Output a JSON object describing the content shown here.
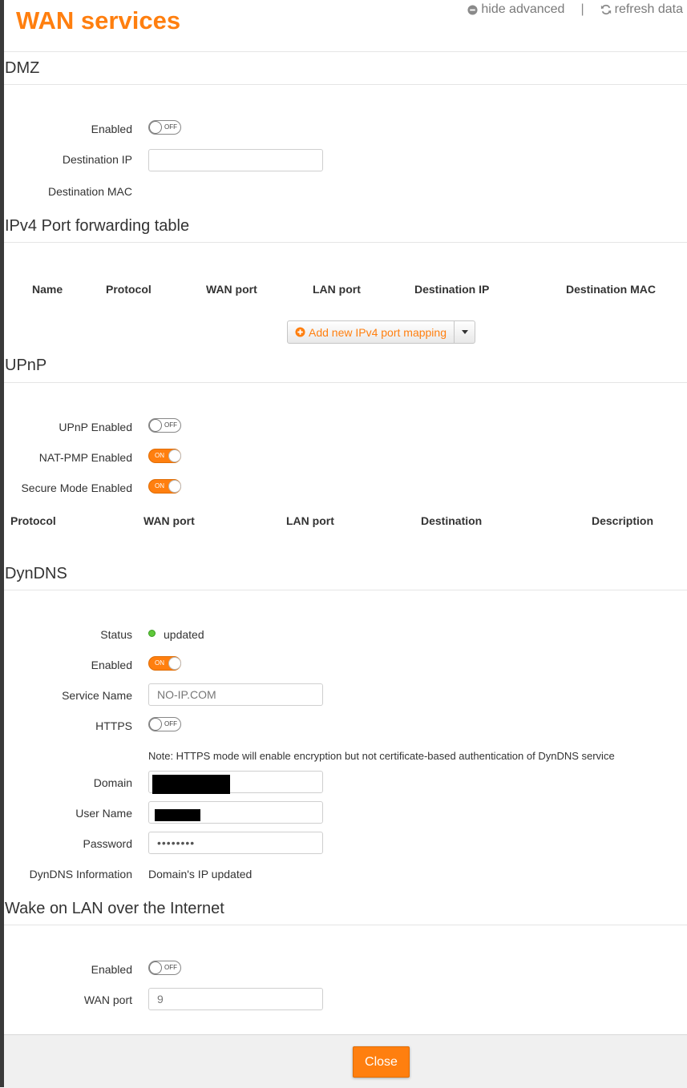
{
  "page": {
    "title": "WAN services"
  },
  "header": {
    "hide_advanced": "hide advanced",
    "separator": "|",
    "refresh_data": "refresh data"
  },
  "switch_text": {
    "on": "ON",
    "off": "OFF"
  },
  "dmz": {
    "title": "DMZ",
    "enabled_label": "Enabled",
    "enabled": false,
    "dest_ip_label": "Destination IP",
    "dest_ip_value": "",
    "dest_mac_label": "Destination MAC"
  },
  "ipv4": {
    "title": "IPv4 Port forwarding table",
    "columns": [
      "Name",
      "Protocol",
      "WAN port",
      "LAN port",
      "Destination IP",
      "Destination MAC"
    ],
    "add_button": "Add new IPv4 port mapping"
  },
  "upnp": {
    "title": "UPnP",
    "upnp_enabled_label": "UPnP Enabled",
    "upnp_enabled": false,
    "natpmp_label": "NAT-PMP Enabled",
    "natpmp": true,
    "secure_label": "Secure Mode Enabled",
    "secure": true,
    "columns": [
      "Protocol",
      "WAN port",
      "LAN port",
      "Destination",
      "Description"
    ]
  },
  "dyndns": {
    "title": "DynDNS",
    "status_label": "Status",
    "status_value": "updated",
    "enabled_label": "Enabled",
    "enabled": true,
    "service_label": "Service Name",
    "service_value": "NO-IP.COM",
    "https_label": "HTTPS",
    "https": false,
    "note": "Note: HTTPS mode will enable encryption but not certificate-based authentication of DynDNS service",
    "domain_label": "Domain",
    "username_label": "User Name",
    "password_label": "Password",
    "password_mask": "••••••••",
    "info_label": "DynDNS Information",
    "info_value": "Domain's IP updated"
  },
  "wol": {
    "title": "Wake on LAN over the Internet",
    "enabled_label": "Enabled",
    "enabled": false,
    "wan_port_label": "WAN port",
    "wan_port_value": "9"
  },
  "footer": {
    "close": "Close"
  },
  "colors": {
    "accent": "#ff7f0f",
    "status_ok": "#5fc83a"
  }
}
